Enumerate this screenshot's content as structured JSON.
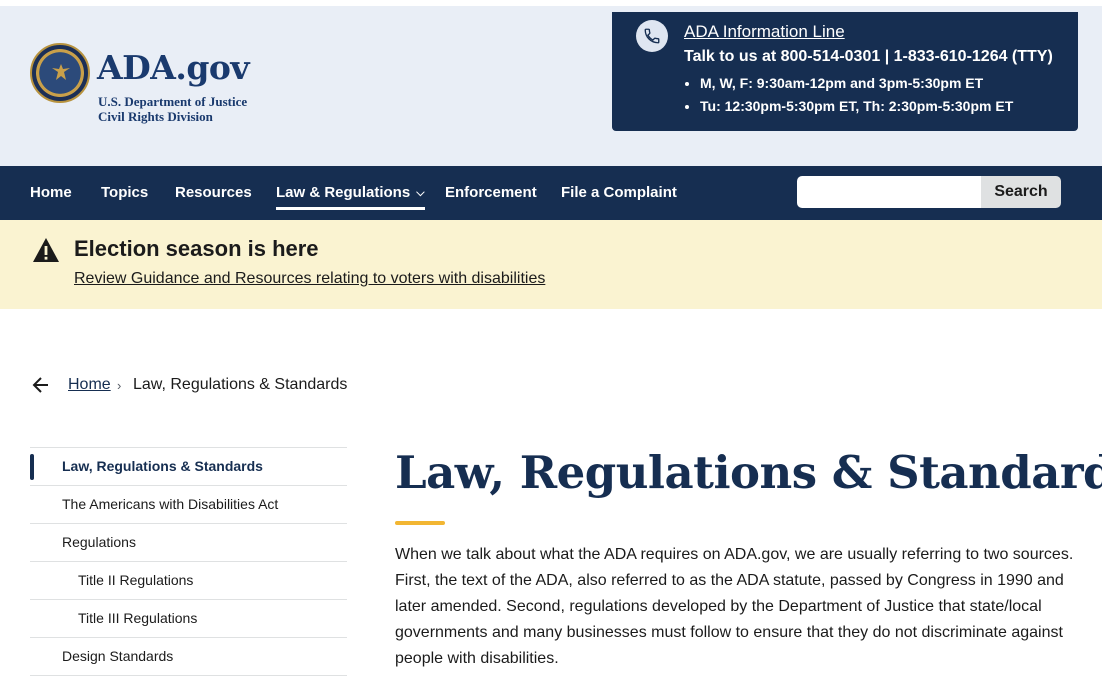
{
  "header": {
    "site_name": "ADA.gov",
    "agency_line1": "U.S. Department of Justice",
    "agency_line2": "Civil Rights Division",
    "info_line": {
      "link": "ADA Information Line",
      "talk": "Talk to us at 800-514-0301 | 1-833-610-1264 (TTY)",
      "hours": [
        "M, W, F: 9:30am-12pm and 3pm-5:30pm ET",
        "Tu: 12:30pm-5:30pm ET, Th: 2:30pm-5:30pm ET"
      ]
    }
  },
  "nav": {
    "items": [
      "Home",
      "Topics",
      "Resources",
      "Law & Regulations",
      "Enforcement",
      "File a Complaint"
    ],
    "active": "Law & Regulations",
    "search_button": "Search",
    "search_value": ""
  },
  "alert": {
    "title": "Election season is here",
    "link": "Review Guidance and Resources relating to voters with disabilities"
  },
  "breadcrumb": {
    "home": "Home",
    "separator": "›",
    "current": "Law, Regulations & Standards"
  },
  "sidenav": {
    "items": [
      "Law, Regulations & Standards",
      "The Americans with Disabilities Act",
      "Regulations",
      "Title II Regulations",
      "Title III Regulations",
      "Design Standards"
    ]
  },
  "main": {
    "title": "Law, Regulations & Standards",
    "intro": "When we talk about what the ADA requires on ADA.gov, we are usually referring to two sources. First, the text of the ADA, also referred to as the ADA statute, passed by Congress in 1990 and later amended. Second, regulations developed by the Department of Justice that state/local governments and many businesses must follow to ensure that they do not discriminate against people with disabilities."
  },
  "colors": {
    "navy": "#162e51",
    "header_bg": "#e9eef6",
    "alert_bg": "#faf3d1",
    "accent_gold": "#f2b632"
  }
}
